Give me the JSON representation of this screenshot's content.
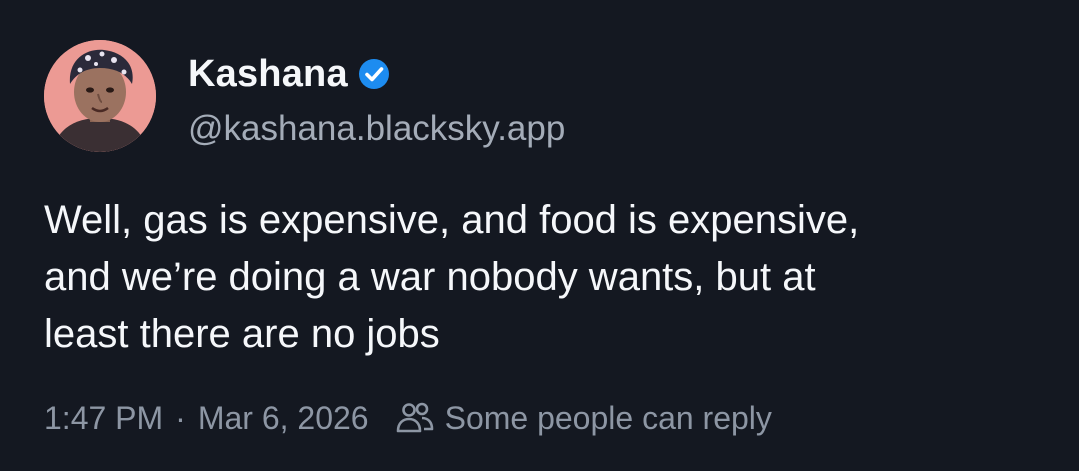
{
  "post": {
    "author": {
      "display_name": "Kashana",
      "handle": "@kashana.blacksky.app",
      "verified": true,
      "avatar_icon": "avatar-illustration",
      "verified_icon": "verified-check-icon"
    },
    "text": "Well, gas is expensive, and food is expensive,\nand we’re doing a war nobody wants, but at\nleast there are no jobs",
    "time": "1:47 PM",
    "separator": "·",
    "date": "Mar 6, 2026",
    "reply_setting_icon": "people-icon",
    "reply_setting": "Some people can reply"
  },
  "colors": {
    "background": "#141821",
    "primary_text": "#f5f7fa",
    "secondary_text": "#a4acb8",
    "meta_text": "#8d96a4",
    "verified_blue": "#1d8cf0",
    "avatar_bg": "#ec9a94"
  }
}
